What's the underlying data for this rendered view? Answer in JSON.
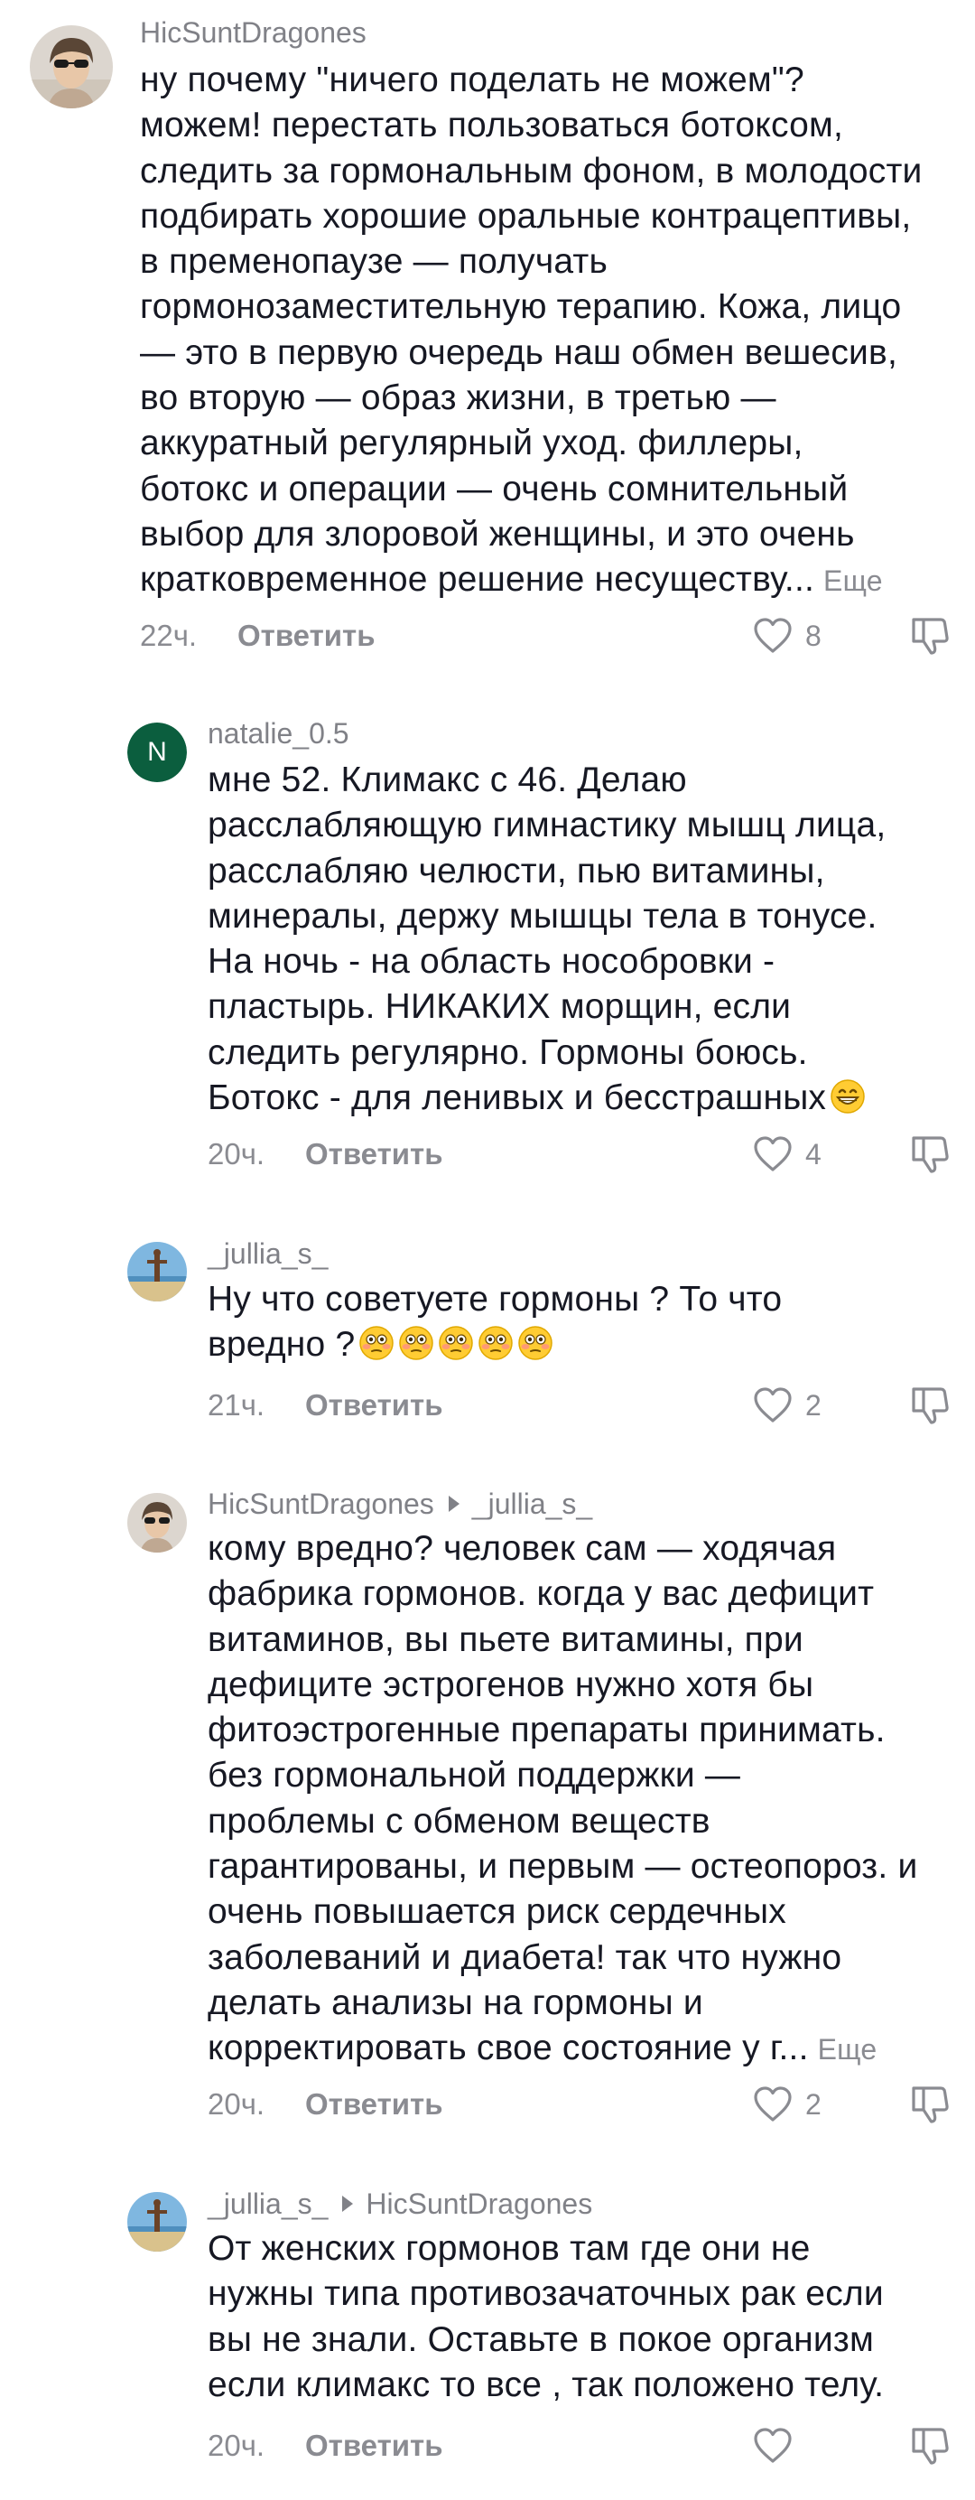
{
  "comments": [
    {
      "username": "HicSuntDragones",
      "reply_to": "",
      "lines": [
        "ну почему \"ничего поделать не можем\"?",
        "можем! перестать пользоваться ботоксом,",
        "следить за гормональным фоном, в молодости",
        "подбирать хорошие оральные контрацептивы,",
        "в пременопаузе — получать",
        "гормонозаместительную терапию. Кожа, лицо",
        "— это в первую очередь наш обмен вешесив,",
        "во вторую — образ жизни, в третью —",
        "аккуратный регулярный уход. филлеры,",
        "ботокс и операции — очень сомнительный",
        "выбор для злоровой женщины, и это очень",
        "кратковременное решение несуществу..."
      ],
      "more_label": "Еще",
      "time": "22ч.",
      "reply_label": "Ответить",
      "likes": "8"
    },
    {
      "username": "natalie_0.5",
      "avatar_letter": "N",
      "reply_to": "",
      "lines": [
        "мне 52. Климакс с 46. Делаю",
        "расслабляющую гимнастику мышц лица,",
        "расслабляю челюсти, пью витамины,",
        "минералы, держу мышцы тела в тонусе.",
        "На ночь - на область нособровки -",
        "пластырь. НИКАКИХ морщин, если",
        "следить регулярно. Гормоны боюсь.",
        "Ботокс - для ленивых и бесстрашных"
      ],
      "emoji_grin": "grinning-face-icon",
      "time": "20ч.",
      "reply_label": "Ответить",
      "likes": "4"
    },
    {
      "username": "_jullia_s_",
      "reply_to": "",
      "lines": [
        "Ну что советуете гормоны ? То что",
        "вредно ?"
      ],
      "emoji_flushed_count": 5,
      "time": "21ч.",
      "reply_label": "Ответить",
      "likes": "2"
    },
    {
      "username": "HicSuntDragones",
      "reply_to": "_jullia_s_",
      "lines": [
        "кому вредно? человек сам — ходячая",
        "фабрика гормонов. когда у вас дефицит",
        "витаминов, вы пьете витамины, при",
        "дефиците эстрогенов нужно хотя бы",
        "фитоэстрогенные препараты принимать.",
        "без гормональной поддержки —",
        "проблемы с обменом веществ",
        "гарантированы, и первым — остеопороз. и",
        "очень повышается риск сердечных",
        "заболеваний и диабета! так что нужно",
        "делать анализы на гормоны и",
        "корректировать свое состояние у г..."
      ],
      "more_label": "Еще",
      "time": "20ч.",
      "reply_label": "Ответить",
      "likes": "2"
    },
    {
      "username": "_jullia_s_",
      "reply_to": "HicSuntDragones",
      "lines": [
        "От женских гормонов там где они не",
        "нужны типа противозачаточных рак если",
        "вы не знали. Оставьте в покое организм",
        "если климакс то все , так положено телу."
      ],
      "time": "20ч.",
      "reply_label": "Ответить",
      "likes": ""
    }
  ],
  "colors": {
    "text": "#161823",
    "secondary": "#808187",
    "natalie_avatar": "#0b5e3e"
  }
}
